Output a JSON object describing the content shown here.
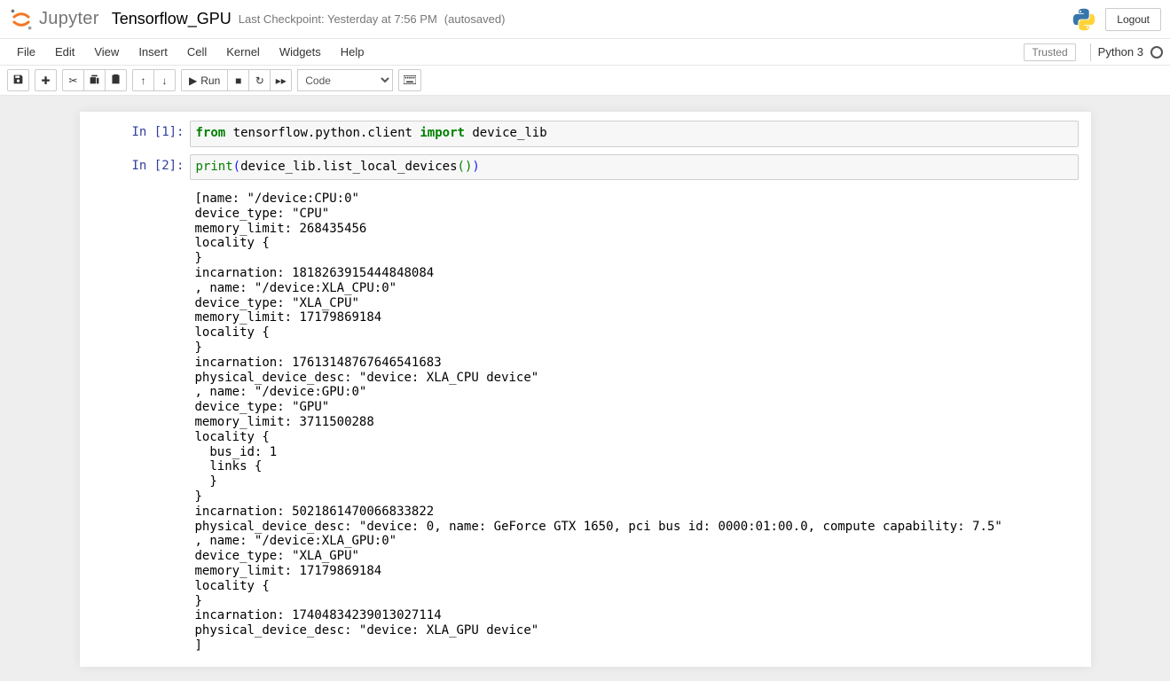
{
  "header": {
    "logoText": "Jupyter",
    "notebookName": "Tensorflow_GPU",
    "checkpoint": "Last Checkpoint: Yesterday at 7:56 PM",
    "autosave": "(autosaved)",
    "logout": "Logout"
  },
  "menubar": {
    "items": [
      "File",
      "Edit",
      "View",
      "Insert",
      "Cell",
      "Kernel",
      "Widgets",
      "Help"
    ],
    "trusted": "Trusted",
    "kernel": "Python 3"
  },
  "toolbar": {
    "runLabel": "Run",
    "cellTypeSelected": "Code"
  },
  "cells": [
    {
      "promptIn": "In [1]:",
      "code": {
        "from": "from",
        "mod": " tensorflow.python.client ",
        "import": "import",
        "what": " device_lib"
      }
    },
    {
      "promptIn": "In [2]:",
      "code": {
        "fn": "print",
        "pOpen": "(",
        "inner": "device_lib.list_local_devices",
        "innerOpen": "(",
        "innerClose": ")",
        "pClose": ")"
      },
      "output": "[name: \"/device:CPU:0\"\ndevice_type: \"CPU\"\nmemory_limit: 268435456\nlocality {\n}\nincarnation: 1818263915444848084\n, name: \"/device:XLA_CPU:0\"\ndevice_type: \"XLA_CPU\"\nmemory_limit: 17179869184\nlocality {\n}\nincarnation: 17613148767646541683\nphysical_device_desc: \"device: XLA_CPU device\"\n, name: \"/device:GPU:0\"\ndevice_type: \"GPU\"\nmemory_limit: 3711500288\nlocality {\n  bus_id: 1\n  links {\n  }\n}\nincarnation: 5021861470066833822\nphysical_device_desc: \"device: 0, name: GeForce GTX 1650, pci bus id: 0000:01:00.0, compute capability: 7.5\"\n, name: \"/device:XLA_GPU:0\"\ndevice_type: \"XLA_GPU\"\nmemory_limit: 17179869184\nlocality {\n}\nincarnation: 17404834239013027114\nphysical_device_desc: \"device: XLA_GPU device\"\n]"
    }
  ]
}
